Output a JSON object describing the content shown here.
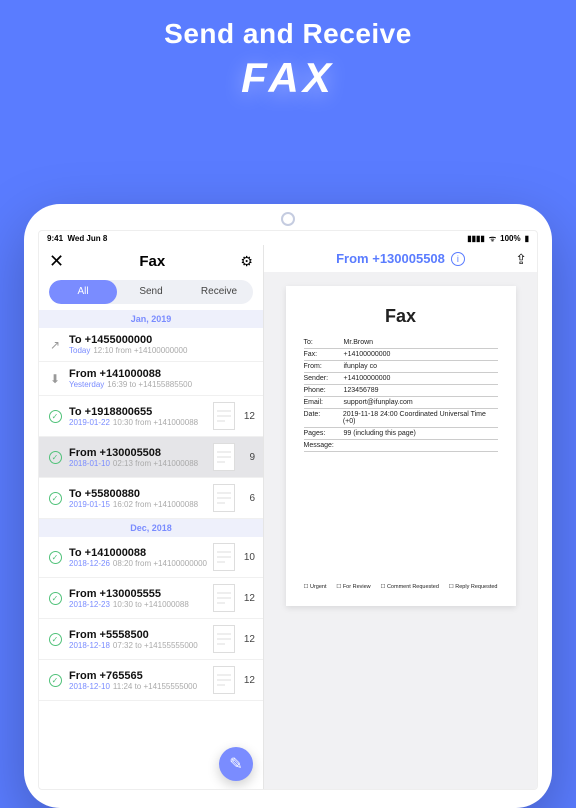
{
  "hero": {
    "line1": "Send and Receive",
    "line2": "FAX"
  },
  "status": {
    "time": "9:41",
    "date": "Wed Jun 8",
    "battery": "100%"
  },
  "leftHeader": {
    "title": "Fax"
  },
  "seg": {
    "all": "All",
    "send": "Send",
    "receive": "Receive"
  },
  "sections": {
    "a": "Jan, 2019",
    "b": "Dec, 2018"
  },
  "rows": [
    {
      "icon": "↗",
      "iconStyle": "gray",
      "title": "To +1455000000",
      "date": "Today",
      "sub": "12:10  from +14100000000",
      "pages": ""
    },
    {
      "icon": "⬇",
      "iconStyle": "gray",
      "title": "From +141000088",
      "date": "Yesterday",
      "sub": "16:39  to +14155885500",
      "pages": ""
    },
    {
      "icon": "✓",
      "iconStyle": "ok",
      "title": "To +1918800655",
      "date": "2019-01-22",
      "sub": "10:30  from +141000088",
      "pages": "12"
    },
    {
      "icon": "✓",
      "iconStyle": "ok",
      "title": "From +130005508",
      "date": "2018-01-10",
      "sub": "02:13  from +141000088",
      "pages": "9",
      "selected": true
    },
    {
      "icon": "✓",
      "iconStyle": "ok",
      "title": "To +55800880",
      "date": "2019-01-15",
      "sub": "16:02  from +141000088",
      "pages": "6"
    },
    {
      "icon": "✓",
      "iconStyle": "ok",
      "title": "To +141000088",
      "date": "2018-12-26",
      "sub": "08:20  from +14100000000",
      "pages": "10"
    },
    {
      "icon": "✓",
      "iconStyle": "ok",
      "title": "From +130005555",
      "date": "2018-12-23",
      "sub": "10:30  to +141000088",
      "pages": "12"
    },
    {
      "icon": "✓",
      "iconStyle": "ok",
      "title": "From +5558500",
      "date": "2018-12-18",
      "sub": "07:32  to +14155555000",
      "pages": "12"
    },
    {
      "icon": "✓",
      "iconStyle": "ok",
      "title": "From +765565",
      "date": "2018-12-10",
      "sub": "11:24  to +14155555000",
      "pages": "12"
    }
  ],
  "rightHeader": {
    "title": "From +130005508"
  },
  "doc": {
    "heading": "Fax",
    "fields": [
      {
        "k": "To:",
        "v": "Mr.Brown"
      },
      {
        "k": "Fax:",
        "v": "+14100000000"
      },
      {
        "k": "From:",
        "v": "ifunplay co"
      },
      {
        "k": "Sender:",
        "v": "+14100000000"
      },
      {
        "k": "Phone:",
        "v": "123456789"
      },
      {
        "k": "Email:",
        "v": "support@ifunplay.com"
      },
      {
        "k": "Date:",
        "v": "2019-11-18 24:00 Coordinated Universal Time (+0)"
      },
      {
        "k": "Pages:",
        "v": "99 (including this page)"
      },
      {
        "k": "Message:",
        "v": ""
      }
    ],
    "checks": [
      "Urgent",
      "For Review",
      "Comment Requested",
      "Reply Requested"
    ]
  }
}
